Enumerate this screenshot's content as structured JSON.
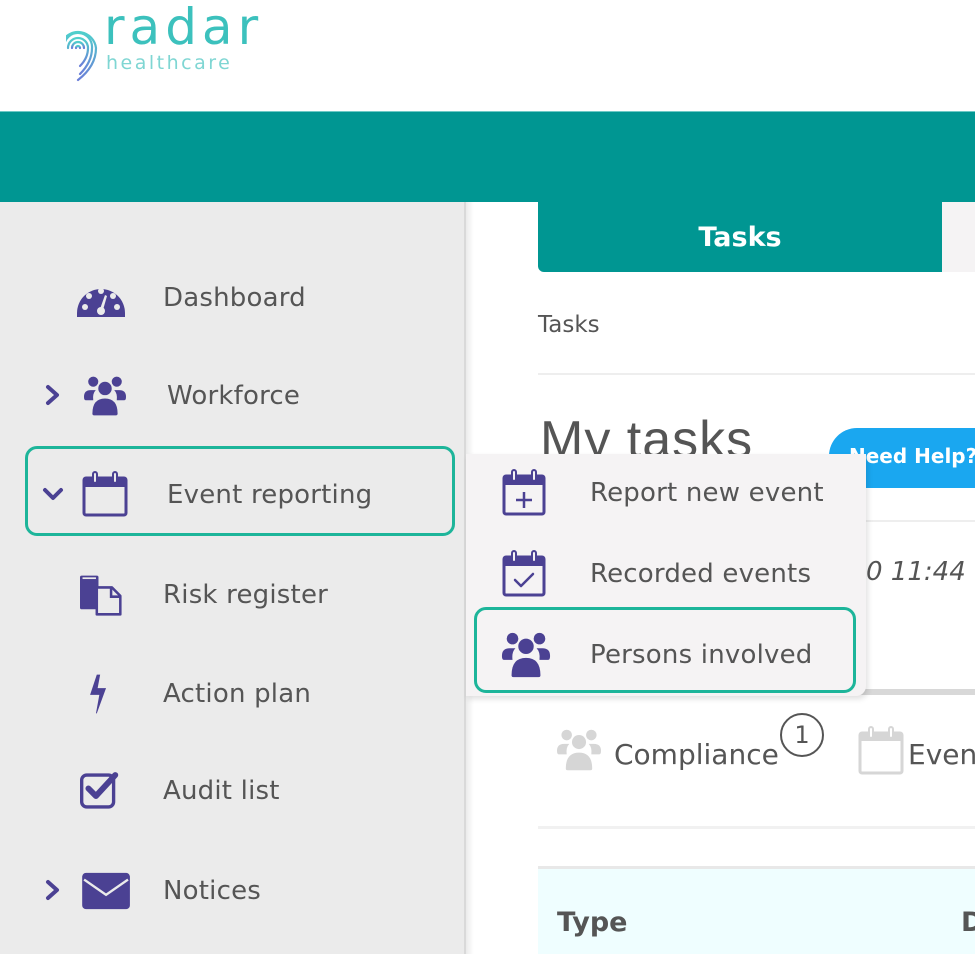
{
  "brand": {
    "name": "radar",
    "subtitle": "healthcare",
    "colors": {
      "teal": "#009692",
      "logo_teal": "#3cc1bd",
      "nav_icon_purple": "#4b4193",
      "highlight_green": "#1db59a",
      "help_blue": "#1aa7f0"
    }
  },
  "sidebar": {
    "items": [
      {
        "label": "Dashboard",
        "icon": "dashboard-gauge-icon",
        "expander": null
      },
      {
        "label": "Workforce",
        "icon": "users-group-icon",
        "expander": "chevron-right"
      },
      {
        "label": "Event reporting",
        "icon": "calendar-icon",
        "expander": "chevron-down",
        "expanded": true,
        "highlighted": true
      },
      {
        "label": "Risk register",
        "icon": "documents-icon",
        "expander": null
      },
      {
        "label": "Action plan",
        "icon": "lightning-bolt-icon",
        "expander": null
      },
      {
        "label": "Audit list",
        "icon": "checkbox-checked-icon",
        "expander": null
      },
      {
        "label": "Notices",
        "icon": "envelope-icon",
        "expander": "chevron-right"
      }
    ]
  },
  "submenu": {
    "parent": "Event reporting",
    "items": [
      {
        "label": "Report new event",
        "icon": "calendar-plus-icon"
      },
      {
        "label": "Recorded events",
        "icon": "calendar-check-icon"
      },
      {
        "label": "Persons involved",
        "icon": "users-group-icon",
        "highlighted": true
      }
    ]
  },
  "main": {
    "tabs": [
      {
        "label": "Tasks",
        "active": true
      },
      {
        "label": "",
        "active": false
      }
    ],
    "breadcrumb": "Tasks",
    "page_title": "My tasks",
    "help_button": "Need Help?",
    "task_timestamp_partial": "0 11:44",
    "category_tabs": [
      {
        "label": "Compliance",
        "icon": "users-group-icon",
        "badge": "1"
      },
      {
        "label": "Even",
        "icon": "calendar-icon"
      }
    ],
    "table": {
      "columns": [
        "Type",
        "D"
      ]
    }
  }
}
